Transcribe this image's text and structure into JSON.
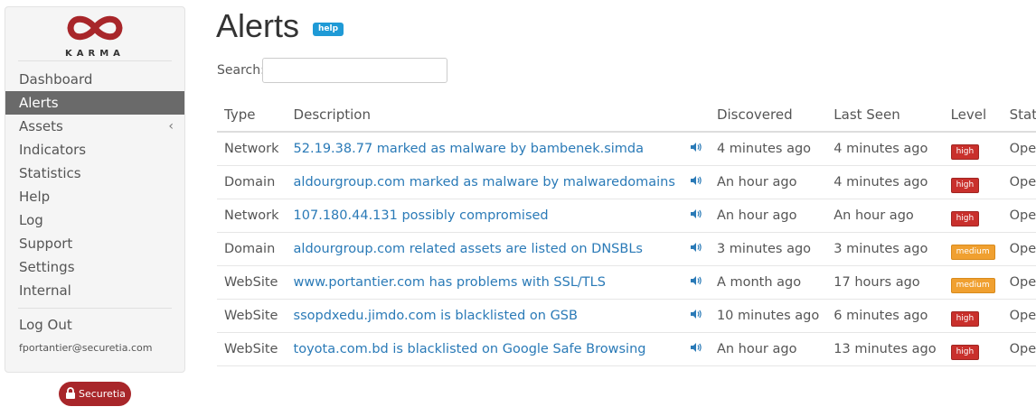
{
  "brand": {
    "logo_text": "KARMA",
    "badge_text": "Securetia",
    "logo_color": "#a8262a"
  },
  "sidebar": {
    "items": [
      {
        "label": "Dashboard"
      },
      {
        "label": "Alerts",
        "active": true
      },
      {
        "label": "Assets",
        "has_submenu": true
      },
      {
        "label": "Indicators"
      },
      {
        "label": "Statistics"
      },
      {
        "label": "Help"
      },
      {
        "label": "Log"
      },
      {
        "label": "Support"
      },
      {
        "label": "Settings"
      },
      {
        "label": "Internal"
      }
    ],
    "logout_label": "Log Out",
    "user_email": "fportantier@securetia.com"
  },
  "main": {
    "title": "Alerts",
    "help_label": "help",
    "search_label": "Search:",
    "search_value": "",
    "columns": [
      "Type",
      "Description",
      "",
      "Discovered",
      "Last Seen",
      "Level",
      "Status"
    ],
    "rows": [
      {
        "type": "Network",
        "description": "52.19.38.77 marked as malware by bambenek.simda",
        "discovered": "4 minutes ago",
        "last_seen": "4 minutes ago",
        "level": "high",
        "status": "Open"
      },
      {
        "type": "Domain",
        "description": "aldourgroup.com marked as malware by malwaredomains",
        "discovered": "An hour ago",
        "last_seen": "4 minutes ago",
        "level": "high",
        "status": "Open"
      },
      {
        "type": "Network",
        "description": "107.180.44.131 possibly compromised",
        "discovered": "An hour ago",
        "last_seen": "An hour ago",
        "level": "high",
        "status": "Open"
      },
      {
        "type": "Domain",
        "description": "aldourgroup.com related assets are listed on DNSBLs",
        "discovered": "3 minutes ago",
        "last_seen": "3 minutes ago",
        "level": "medium",
        "status": "Open"
      },
      {
        "type": "WebSite",
        "description": "www.portantier.com has problems with SSL/TLS",
        "discovered": "A month ago",
        "last_seen": "17 hours ago",
        "level": "medium",
        "status": "Open"
      },
      {
        "type": "WebSite",
        "description": "ssopdxedu.jimdo.com is blacklisted on GSB",
        "discovered": "10 minutes ago",
        "last_seen": "6 minutes ago",
        "level": "high",
        "status": "Open"
      },
      {
        "type": "WebSite",
        "description": "toyota.com.bd is blacklisted on Google Safe Browsing",
        "discovered": "An hour ago",
        "last_seen": "13 minutes ago",
        "level": "high",
        "status": "Open"
      }
    ],
    "speaker_icon": "speaker-icon"
  }
}
